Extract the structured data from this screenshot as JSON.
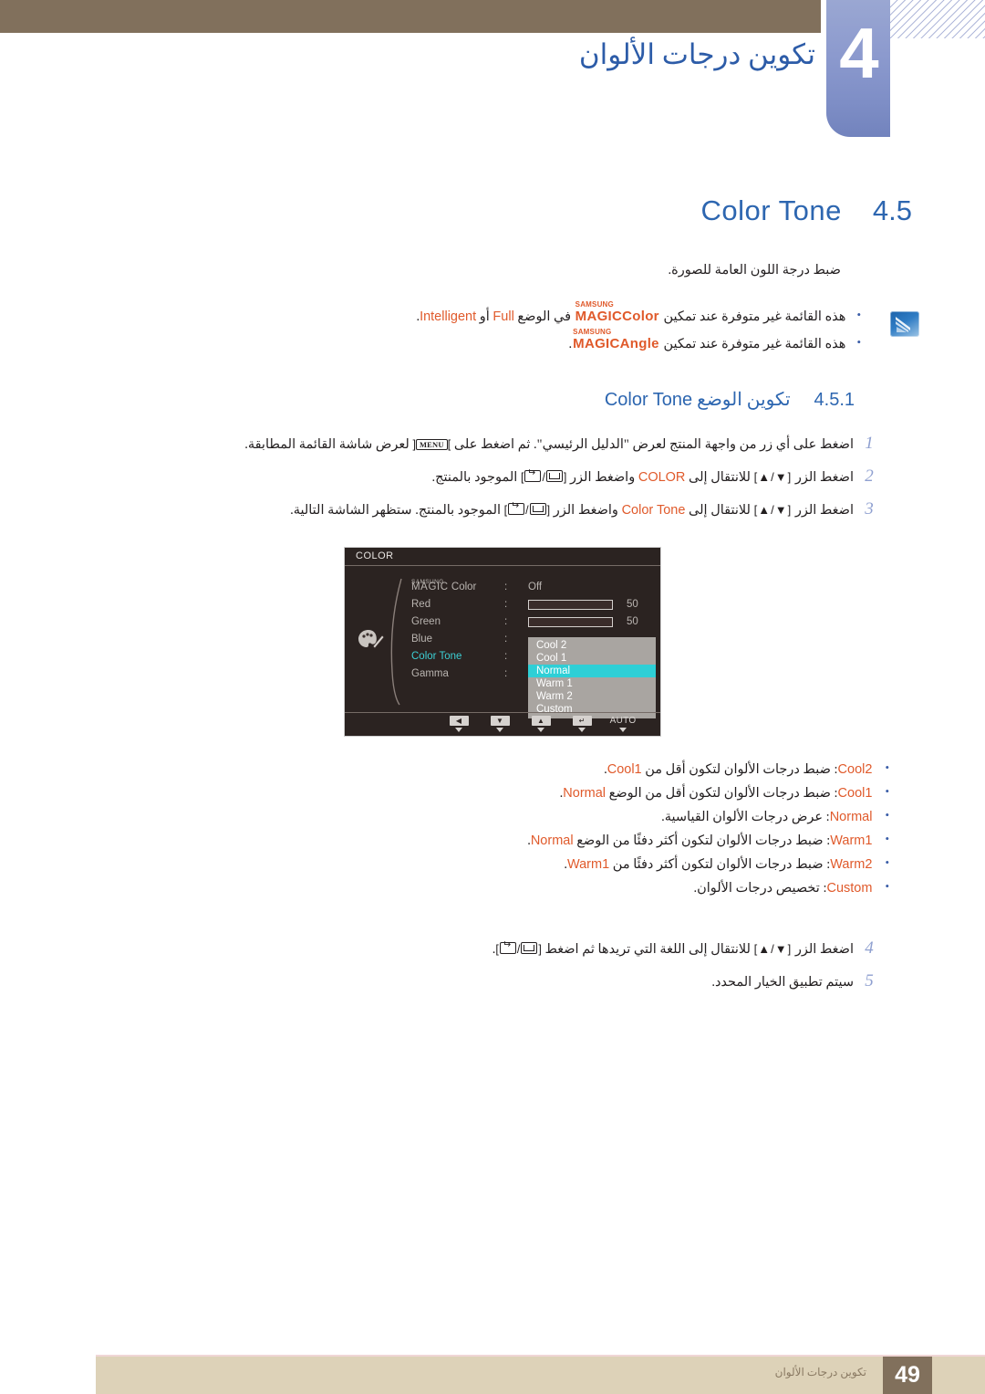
{
  "header": {
    "chapter_number": "4",
    "chapter_title": "تكوين درجات الألوان"
  },
  "section": {
    "number": "4.5",
    "title": "Color Tone",
    "intro": "ضبط درجة اللون العامة للصورة."
  },
  "notes": {
    "icon_name": "samsung-note-icon",
    "items": [
      {
        "bullet": "•",
        "pre": "هذه القائمة غير متوفرة عند تمكين",
        "magic_sup": "SAMSUNG",
        "magic_main": "MAGIC",
        "magic_suffix": "Color",
        "mid": "في الوضع",
        "term1": "Full",
        "conj": "أو",
        "term2": "Intelligent",
        "post": "."
      },
      {
        "bullet": "•",
        "pre": "هذه القائمة غير متوفرة عند تمكين",
        "magic_sup": "SAMSUNG",
        "magic_main": "MAGIC",
        "magic_suffix": "Angle",
        "post": "."
      }
    ]
  },
  "subsection": {
    "number": "4.5.1",
    "title_ar": "تكوين الوضع",
    "title_en": "Color Tone"
  },
  "steps": [
    {
      "num": "1",
      "p1": "اضغط على أي زر من واجهة المنتج لعرض \"الدليل الرئيسي\". ثم اضغط على",
      "key": "MENU",
      "p2": "لعرض شاشة القائمة المطابقة."
    },
    {
      "num": "2",
      "p1": "اضغط الزر",
      "arrows": "[▲/▼]",
      "p2": "للانتقال إلى",
      "target": "COLOR",
      "p3": "واضغط الزر",
      "p4": "الموجود بالمنتج."
    },
    {
      "num": "3",
      "p1": "اضغط الزر",
      "arrows": "[▲/▼]",
      "p2": "للانتقال إلى",
      "target": "Color Tone",
      "p3": "واضغط الزر",
      "p4": "الموجود بالمنتج. ستظهر الشاشة التالية."
    }
  ],
  "steps2": [
    {
      "num": "4",
      "p1": "اضغط الزر",
      "arrows": "[▲/▼]",
      "p2": "للانتقال إلى اللغة التي تريدها ثم اضغط",
      "p3": "."
    },
    {
      "num": "5",
      "p1": "سيتم تطبيق الخيار المحدد."
    }
  ],
  "osd": {
    "title": "COLOR",
    "magic_sup": "SAMSUNG",
    "magic_main": "MAGIC",
    "items": [
      {
        "label": "Color",
        "is_magic": true,
        "colon": ":",
        "value": "Off",
        "type": "value"
      },
      {
        "label": "Red",
        "colon": ":",
        "value": "50",
        "type": "slider",
        "fill_pct": 50
      },
      {
        "label": "Green",
        "colon": ":",
        "value": "50",
        "type": "slider",
        "fill_pct": 50
      },
      {
        "label": "Blue",
        "colon": ":",
        "type": "hidden"
      },
      {
        "label": "Color Tone",
        "colon": ":",
        "type": "active"
      },
      {
        "label": "Gamma",
        "colon": ":",
        "type": "hidden"
      }
    ],
    "dropdown": {
      "options": [
        "Cool 2",
        "Cool 1",
        "Normal",
        "Warm 1",
        "Warm 2",
        "Custom"
      ],
      "selected": "Normal"
    },
    "buttons": [
      {
        "name": "left-button",
        "glyph": "◀"
      },
      {
        "name": "down-button",
        "glyph": "▼"
      },
      {
        "name": "up-button",
        "glyph": "▲"
      },
      {
        "name": "enter-button",
        "glyph": "↵"
      },
      {
        "name": "auto-button",
        "glyph": "AUTO"
      },
      {
        "name": "power-button",
        "glyph": "⏻"
      }
    ],
    "palette_icon": "palette-icon",
    "highlight_color": "#2ecfd6",
    "active_label_color": "#3ccfd4"
  },
  "options": [
    {
      "bullet": "•",
      "name": "Cool2",
      "sep": ":",
      "desc_pre": "ضبط درجات الألوان لتكون أقل من",
      "ref": "Cool1",
      "desc_post": "."
    },
    {
      "bullet": "•",
      "name": "Cool1",
      "sep": ":",
      "desc_pre": "ضبط درجات الألوان لتكون أقل من الوضع",
      "ref": "Normal",
      "desc_post": "."
    },
    {
      "bullet": "•",
      "name": "Normal",
      "sep": ":",
      "desc_pre": "عرض درجات الألوان القياسية.",
      "ref": "",
      "desc_post": ""
    },
    {
      "bullet": "•",
      "name": "Warm1",
      "sep": ":",
      "desc_pre": "ضبط درجات الألوان لتكون أكثر دفئًا من الوضع",
      "ref": "Normal",
      "desc_post": "."
    },
    {
      "bullet": "•",
      "name": "Warm2",
      "sep": ":",
      "desc_pre": "ضبط درجات الألوان لتكون أكثر دفئًا من",
      "ref": "Warm1",
      "desc_post": "."
    },
    {
      "bullet": "•",
      "name": "Custom",
      "sep": ":",
      "desc_pre": "تخصيص درجات الألوان.",
      "ref": "",
      "desc_post": ""
    }
  ],
  "footer": {
    "page_number": "49",
    "text": "تكوين درجات الألوان"
  },
  "colors": {
    "brown": "#81705c",
    "tan": "#ddd2b8",
    "blue_tab": "#8c9ace",
    "heading_blue": "#2d66b0",
    "orange": "#e05a2b",
    "step_num": "#8fa0d0"
  }
}
